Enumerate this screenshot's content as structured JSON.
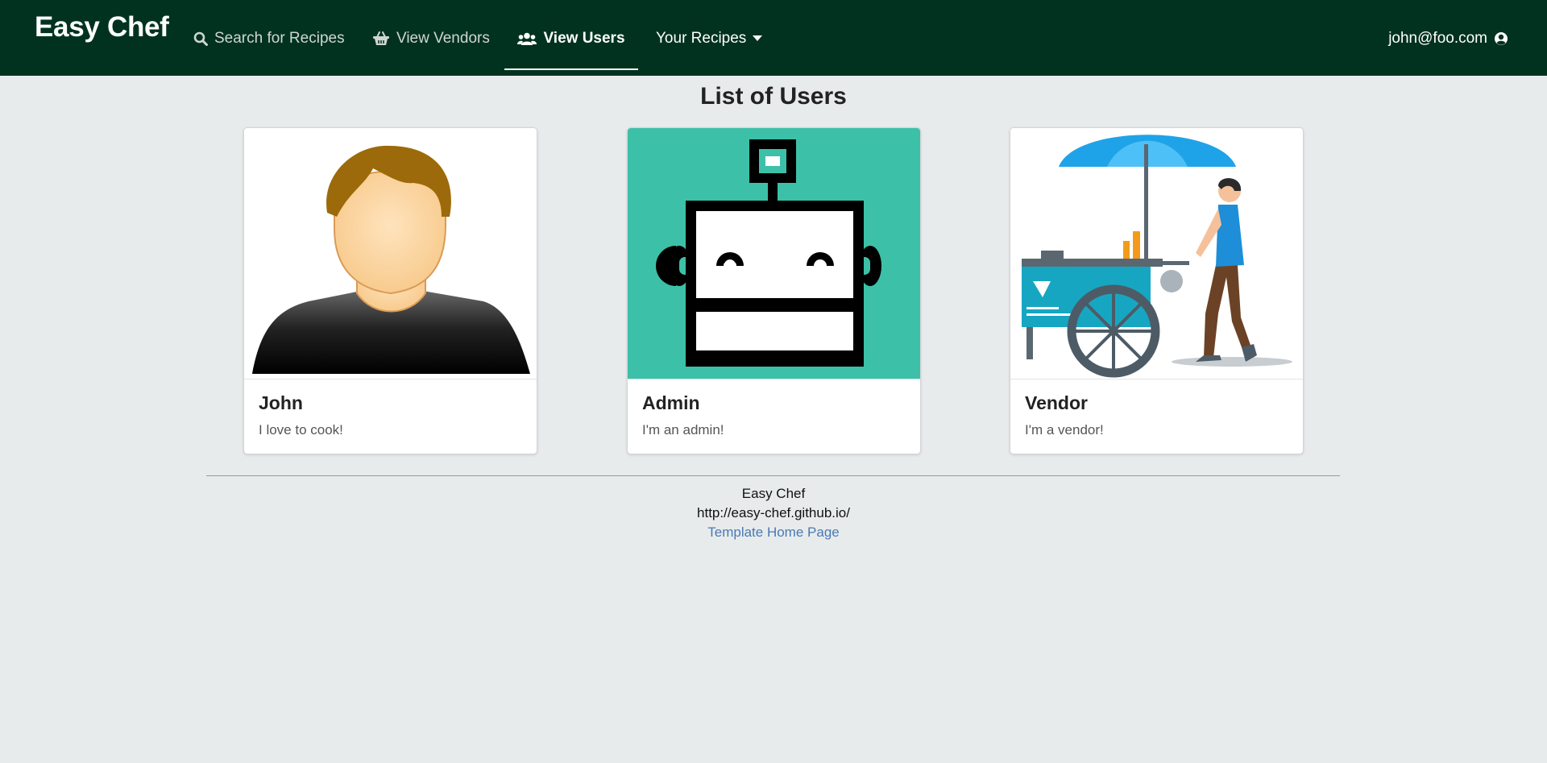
{
  "navbar": {
    "brand": "Easy Chef",
    "items": [
      {
        "label": "Search for Recipes",
        "icon": "search-icon"
      },
      {
        "label": "View Vendors",
        "icon": "basket-icon"
      },
      {
        "label": "View Users",
        "icon": "users-icon",
        "active": true
      },
      {
        "label": "Your Recipes",
        "icon": "caret-down-icon"
      }
    ],
    "user": {
      "email": "john@foo.com",
      "icon": "user-circle-icon"
    },
    "colors": {
      "background": "#013220",
      "text": "#ffffff"
    }
  },
  "main": {
    "title": "List of Users",
    "users": [
      {
        "name": "John",
        "description": "I love to cook!",
        "image": "person-avatar"
      },
      {
        "name": "Admin",
        "description": "I'm an admin!",
        "image": "robot-avatar"
      },
      {
        "name": "Vendor",
        "description": "I'm a vendor!",
        "image": "vendor-cart-illustration"
      }
    ]
  },
  "footer": {
    "app_name": "Easy Chef",
    "url": "http://easy-chef.github.io/",
    "link_label": "Template Home Page",
    "link_color": "#4a7ab5"
  }
}
